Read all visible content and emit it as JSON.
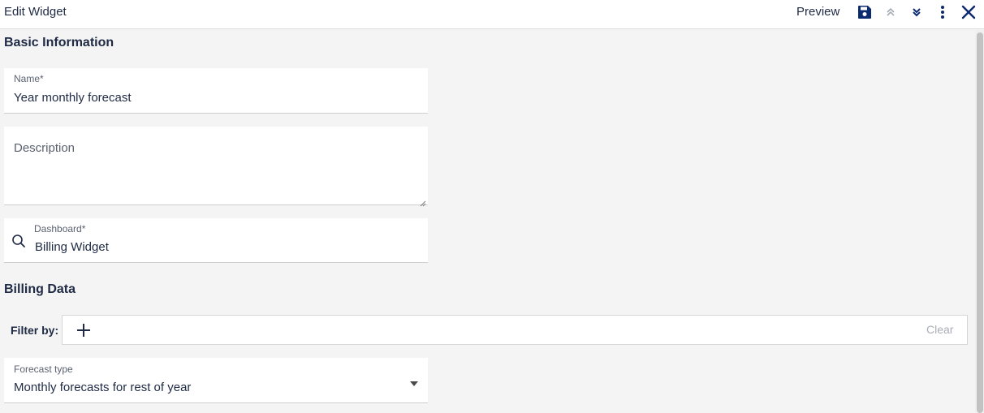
{
  "header": {
    "title": "Edit Widget",
    "preview_label": "Preview"
  },
  "basic_info": {
    "title": "Basic Information",
    "name": {
      "label": "Name*",
      "value": "Year monthly forecast"
    },
    "description": {
      "placeholder": "Description"
    },
    "dashboard": {
      "label": "Dashboard*",
      "value": "Billing Widget"
    }
  },
  "billing_data": {
    "title": "Billing Data",
    "filter_label": "Filter by:",
    "clear_label": "Clear",
    "forecast_type": {
      "label": "Forecast type",
      "value": "Monthly forecasts for rest of year"
    }
  },
  "icons": {
    "save": "save-icon",
    "collapse": "double-chevron-up-icon",
    "expand": "double-chevron-down-icon",
    "more": "more-vertical-icon",
    "close": "close-icon",
    "search": "search-icon",
    "add": "plus-icon",
    "dropdown": "caret-down-icon"
  },
  "colors": {
    "primary": "#1f2a44",
    "accent": "#0b2a6f",
    "disabled": "#a8adb5",
    "background": "#f4f4f4"
  }
}
